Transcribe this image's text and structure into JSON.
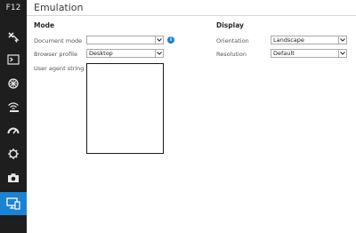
{
  "devtools": {
    "key_label": "F12",
    "tools": [
      {
        "name": "dom-explorer-icon"
      },
      {
        "name": "console-icon"
      },
      {
        "name": "debugger-icon"
      },
      {
        "name": "network-icon"
      },
      {
        "name": "performance-icon"
      },
      {
        "name": "memory-icon"
      },
      {
        "name": "screenshot-icon"
      },
      {
        "name": "emulation-icon",
        "active": true
      }
    ]
  },
  "panel": {
    "title": "Emulation"
  },
  "mode": {
    "heading": "Mode",
    "document_mode_label": "Document mode",
    "document_mode_value": "",
    "browser_profile_label": "Browser profile",
    "browser_profile_value": "Desktop",
    "user_agent_label": "User agent string"
  },
  "display": {
    "heading": "Display",
    "orientation_label": "Orientation",
    "orientation_value": "Landscape",
    "resolution_label": "Resolution",
    "resolution_value": "Default"
  },
  "colors": {
    "sidebar_bg": "#1e1e1e",
    "accent": "#1a83d4"
  }
}
